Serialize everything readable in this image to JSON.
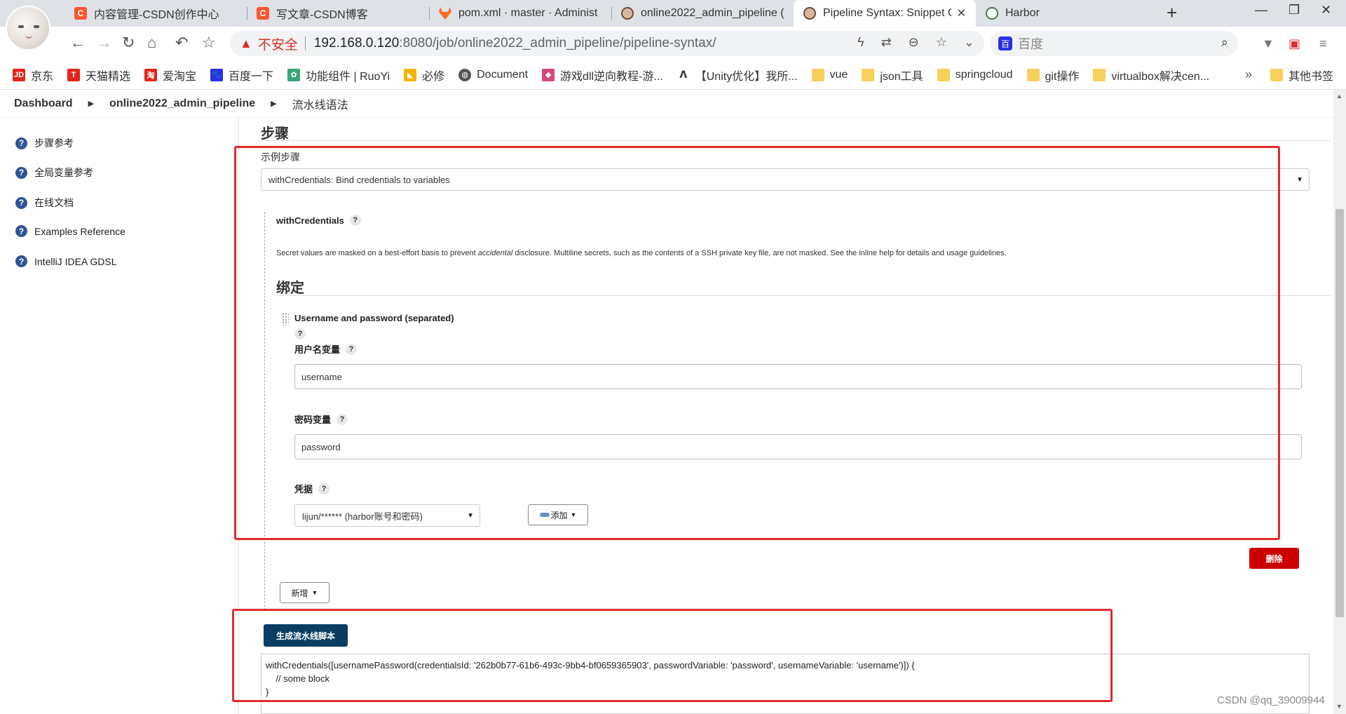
{
  "browser": {
    "tabs": [
      {
        "icon": "csdn-icon",
        "label": "内容管理-CSDN创作中心",
        "active": false
      },
      {
        "icon": "csdn-icon",
        "label": "写文章-CSDN博客",
        "active": false
      },
      {
        "icon": "gitlab-icon",
        "label": "pom.xml · master · Administ",
        "active": false
      },
      {
        "icon": "jenkins-icon",
        "label": "online2022_admin_pipeline (",
        "active": false
      },
      {
        "icon": "jenkins-icon",
        "label": "Pipeline Syntax: Snippet G",
        "active": true
      },
      {
        "icon": "harbor-icon",
        "label": "Harbor",
        "active": false
      }
    ],
    "new_tab": "+",
    "address": {
      "security_label": "不安全",
      "host": "192.168.0.120",
      "rest": ":8080/job/online2022_admin_pipeline/pipeline-syntax/"
    },
    "search_placeholder": "百度",
    "bookmarks": [
      {
        "icon": "jd-icon",
        "label": "京东",
        "color": "#e1251b"
      },
      {
        "icon": "tmall-icon",
        "label": "天猫精选",
        "color": "#e1251b"
      },
      {
        "icon": "taobao-icon",
        "label": "爱淘宝",
        "color": "#e1251b"
      },
      {
        "icon": "baidu-icon",
        "label": "百度一下",
        "color": "#2932e1"
      },
      {
        "icon": "leaf-icon",
        "label": "功能组件 | RuoYi",
        "color": "#3aa57a"
      },
      {
        "icon": "bing-icon",
        "label": "必修",
        "color": "#f5b400"
      },
      {
        "icon": "globe-icon",
        "label": "Document",
        "color": "#555555"
      },
      {
        "icon": "game-icon",
        "label": "游戏dll逆向教程-游...",
        "color": "#d34a7a"
      },
      {
        "icon": "unity-icon",
        "label": "【Unity优化】我所...",
        "color": "#333333"
      },
      {
        "icon": "folder-icon",
        "label": "vue",
        "color": "#f7cf5b"
      },
      {
        "icon": "folder-icon",
        "label": "json工具",
        "color": "#f7cf5b"
      },
      {
        "icon": "folder-icon",
        "label": "springcloud",
        "color": "#f7cf5b"
      },
      {
        "icon": "folder-icon",
        "label": "git操作",
        "color": "#f7cf5b"
      },
      {
        "icon": "folder-icon",
        "label": "virtualbox解决cen...",
        "color": "#f7cf5b"
      }
    ],
    "bookmarks_more": "»",
    "other_bookmarks": "其他书签"
  },
  "breadcrumb": {
    "items": [
      "Dashboard",
      "online2022_admin_pipeline",
      "流水线语法"
    ]
  },
  "sidebar": {
    "items": [
      {
        "label": "步骤参考"
      },
      {
        "label": "全局变量参考"
      },
      {
        "label": "在线文档"
      },
      {
        "label": "Examples Reference"
      },
      {
        "label": "IntelliJ IDEA GDSL"
      }
    ]
  },
  "main": {
    "steps_title": "步骤",
    "sample_step_label": "示例步骤",
    "sample_step_value": "withCredentials: Bind credentials to variables",
    "step_name": "withCredentials",
    "note_before": "Secret values are masked on a best-effort basis to prevent ",
    "note_em": "accidental",
    "note_after": " disclosure. Multiline secrets, such as the contents of a SSH private key file, are not masked. See the inline help for details and usage guidelines.",
    "bindings_title": "绑定",
    "binding_type": "Username and password (separated)",
    "username_var_label": "用户名变量",
    "username_var_value": "username",
    "password_var_label": "密码变量",
    "password_var_value": "password",
    "credentials_label": "凭据",
    "credentials_value": "lijun/****** (harbor账号和密码)",
    "add_button": "添加",
    "delete_button": "删除",
    "new_button": "新增",
    "generate_button": "生成流水线脚本",
    "script_lines": [
      "withCredentials([usernamePassword(credentialsId: '262b0b77-61b6-493c-9bb4-bf0659365903', passwordVariable: 'password', usernameVariable: 'username')]) {",
      "    // some block",
      "}"
    ],
    "help_mark": "?"
  },
  "watermark": "CSDN @qq_39009944",
  "colors": {
    "highlight_box": "#e32b2b",
    "delete_button": "#cc0000",
    "generate_button": "#0b3d62",
    "help_icon": "#2f5597"
  }
}
